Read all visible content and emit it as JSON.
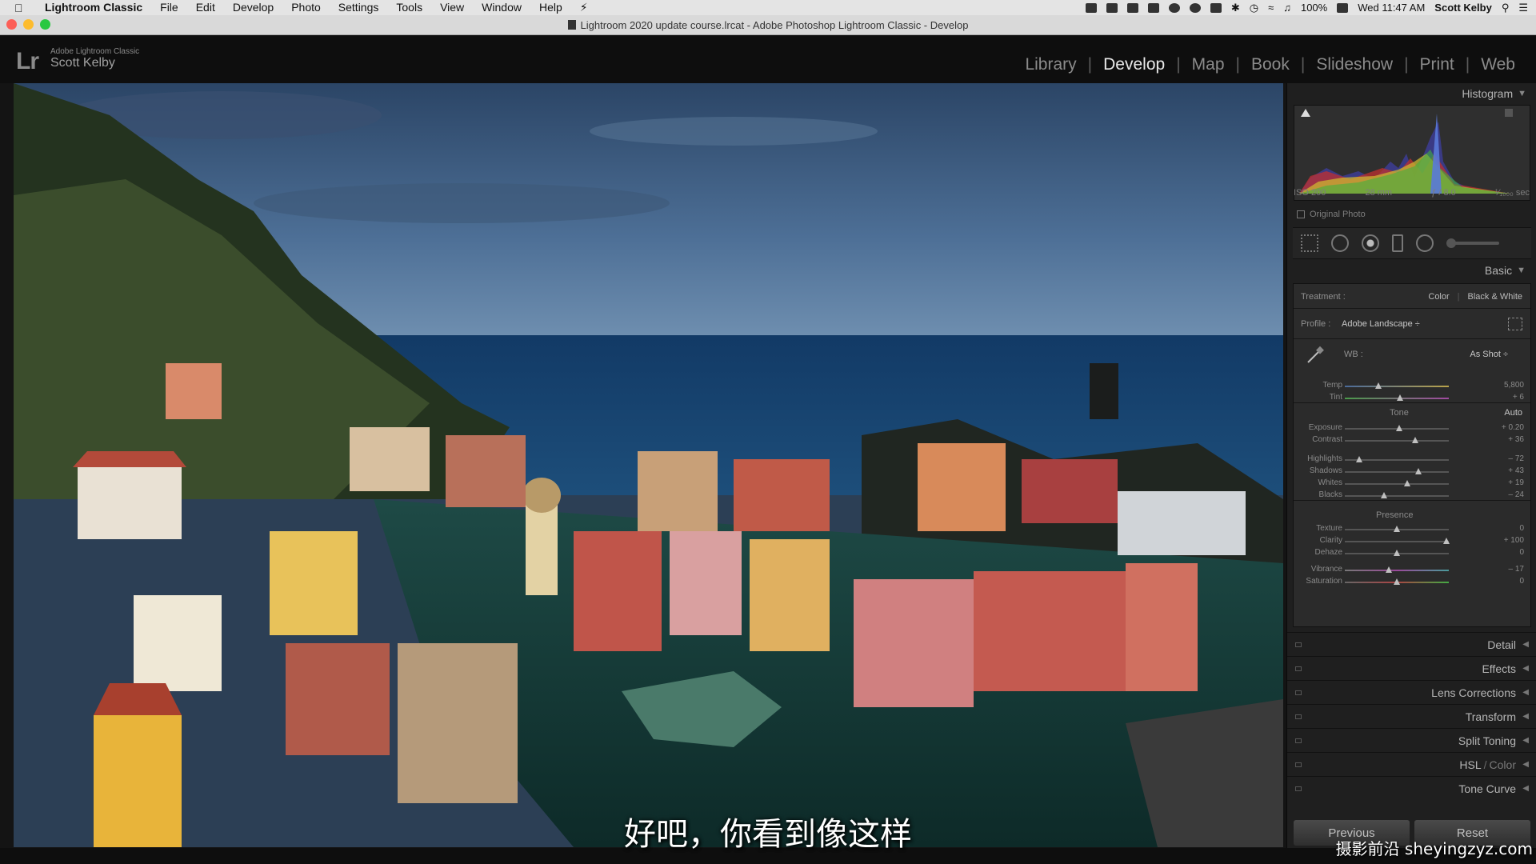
{
  "menubar": {
    "app": "Lightroom Classic",
    "menus": [
      "File",
      "Edit",
      "Develop",
      "Photo",
      "Settings",
      "Tools",
      "View",
      "Window",
      "Help"
    ],
    "battery": "100%",
    "clock": "Wed 11:47 AM",
    "user": "Scott Kelby"
  },
  "titlebar": {
    "title": "Lightroom 2020 update course.lrcat - Adobe Photoshop Lightroom Classic - Develop"
  },
  "identity": {
    "logo": "Lr",
    "product": "Adobe Lightroom Classic",
    "name": "Scott Kelby"
  },
  "modules": [
    "Library",
    "Develop",
    "Map",
    "Book",
    "Slideshow",
    "Print",
    "Web"
  ],
  "active_module": "Develop",
  "histogram": {
    "title": "Histogram",
    "iso": "ISO 200",
    "focal": "28 mm",
    "aperture": "ƒ / 8.0",
    "shutter": "¹⁄₁₀₀₀ sec",
    "original_photo": "Original Photo"
  },
  "basic": {
    "title": "Basic",
    "treatment_label": "Treatment :",
    "treatment_color": "Color",
    "treatment_bw": "Black & White",
    "profile_label": "Profile :",
    "profile_value": "Adobe Landscape ÷",
    "wb_label": "WB :",
    "wb_value": "As Shot ÷",
    "tone_label": "Tone",
    "auto_label": "Auto",
    "presence_label": "Presence",
    "sliders": [
      {
        "key": "temp",
        "label": "Temp",
        "value": "5,800",
        "pos": 0.32
      },
      {
        "key": "tint",
        "label": "Tint",
        "value": "+ 6",
        "pos": 0.53
      },
      {
        "key": "exposure",
        "label": "Exposure",
        "value": "+ 0.20",
        "pos": 0.52
      },
      {
        "key": "contrast",
        "label": "Contrast",
        "value": "+ 36",
        "pos": 0.68
      },
      {
        "key": "highlights",
        "label": "Highlights",
        "value": "– 72",
        "pos": 0.14
      },
      {
        "key": "shadows",
        "label": "Shadows",
        "value": "+ 43",
        "pos": 0.71
      },
      {
        "key": "whites",
        "label": "Whites",
        "value": "+ 19",
        "pos": 0.6
      },
      {
        "key": "blacks",
        "label": "Blacks",
        "value": "– 24",
        "pos": 0.38
      },
      {
        "key": "texture",
        "label": "Texture",
        "value": "0",
        "pos": 0.5
      },
      {
        "key": "clarity",
        "label": "Clarity",
        "value": "+ 100",
        "pos": 0.98
      },
      {
        "key": "dehaze",
        "label": "Dehaze",
        "value": "0",
        "pos": 0.5
      },
      {
        "key": "vibrance",
        "label": "Vibrance",
        "value": "– 17",
        "pos": 0.42
      },
      {
        "key": "saturation",
        "label": "Saturation",
        "value": "0",
        "pos": 0.5
      }
    ]
  },
  "panels": {
    "detail": "Detail",
    "effects": "Effects",
    "lens": "Lens Corrections",
    "transform": "Transform",
    "split": "Split Toning",
    "hsl": "HSL",
    "color": "Color",
    "tonecurve": "Tone Curve"
  },
  "buttons": {
    "previous": "Previous",
    "reset": "Reset"
  },
  "subtitle": "好吧，你看到像这样",
  "watermark": "摄影前沿 sheyingzyz.com"
}
